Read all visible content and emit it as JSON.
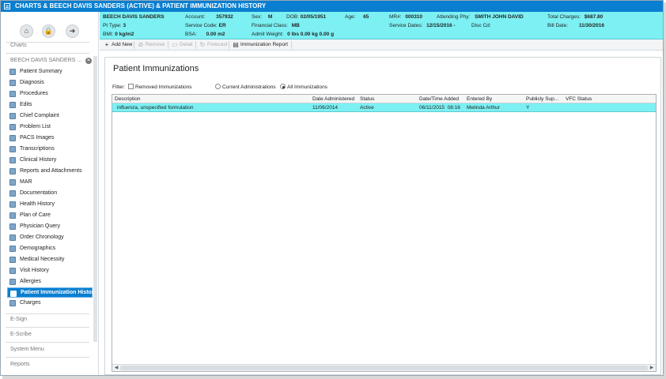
{
  "window": {
    "title": "CHARTS & BEECH DAVIS SANDERS (ACTIVE) & PATIENT IMMUNIZATION HISTORY"
  },
  "sidebar": {
    "icons": [
      "home-icon",
      "lock-icon",
      "logout-icon"
    ],
    "charts_label": "Charts",
    "patient_name": "BEECH DAVIS SANDERS ...",
    "items": [
      {
        "label": "Patient Summary",
        "icon": "summary-icon"
      },
      {
        "label": "Diagnosis",
        "icon": "diagnosis-icon"
      },
      {
        "label": "Procedures",
        "icon": "procedures-icon"
      },
      {
        "label": "Edits",
        "icon": "edits-icon"
      },
      {
        "label": "Chief Complaint",
        "icon": "complaint-icon"
      },
      {
        "label": "Problem List",
        "icon": "problem-list-icon"
      },
      {
        "label": "PACS Images",
        "icon": "images-icon"
      },
      {
        "label": "Transcriptions",
        "icon": "transcriptions-icon"
      },
      {
        "label": "Clinical History",
        "icon": "clinical-history-icon"
      },
      {
        "label": "Reports and Attachments",
        "icon": "reports-icon"
      },
      {
        "label": "MAR",
        "icon": "mar-icon"
      },
      {
        "label": "Documentation",
        "icon": "documentation-icon"
      },
      {
        "label": "Health History",
        "icon": "health-history-icon"
      },
      {
        "label": "Plan of Care",
        "icon": "plan-of-care-icon"
      },
      {
        "label": "Physician Query",
        "icon": "physician-query-icon"
      },
      {
        "label": "Order Chronology",
        "icon": "order-chronology-icon"
      },
      {
        "label": "Demographics",
        "icon": "demographics-icon"
      },
      {
        "label": "Medical Necessity",
        "icon": "medical-necessity-icon"
      },
      {
        "label": "Visit History",
        "icon": "visit-history-icon"
      },
      {
        "label": "Allergies",
        "icon": "allergies-icon"
      },
      {
        "label": "Patient Immunization History",
        "icon": "immunization-icon",
        "selected": true
      },
      {
        "label": "Charges",
        "icon": "charges-icon"
      }
    ],
    "sections": [
      "E-Sign",
      "E-Scribe",
      "System Menu",
      "Reports"
    ]
  },
  "patient": {
    "name": "BEECH DAVIS SANDERS",
    "pt_type_label": "Pt Type:",
    "pt_type": "3",
    "bmi_label": "BMI:",
    "bmi": "0 kg/m2",
    "account_label": "Account:",
    "account": "357932",
    "service_code_label": "Service Code:",
    "service_code": "ER",
    "bsa_label": "BSA:",
    "bsa": "0.00 m2",
    "sex_label": "Sex:",
    "sex": "M",
    "dob_label": "DOB:",
    "dob": "02/05/1951",
    "age_label": "Age:",
    "age": "65",
    "financial_class_label": "Financial Class:",
    "financial_class": "MB",
    "admit_weight_label": "Admit Weight:",
    "admit_weight": "0 lbs 0.00 kg 0.00 g",
    "mr_label": "MR#:",
    "mr": "000310",
    "attending_label": "Attending Phy:",
    "attending": "SMITH JOHN DAVID",
    "service_dates_label": "Service Dates:",
    "service_dates": "12/15/2016 -",
    "disc_cd_label": "Disc Cd:",
    "total_charges_label": "Total Charges:",
    "total_charges": "$687.80",
    "bill_date_label": "Bill Date:",
    "bill_date": "11/30/2016"
  },
  "toolbar": {
    "add_new": "Add New",
    "remove": "Remove",
    "detail": "Detail",
    "forecast": "Forecast",
    "immunization_report": "Immunization Report"
  },
  "main": {
    "title": "Patient Immunizations",
    "filter_label": "Filter:",
    "removed_immunizations": "Removed Immunizations",
    "removed_checked": false,
    "current_administrations": "Current Administrations",
    "all_immunizations": "All Immunizations",
    "selected_filter": "All Immunizations"
  },
  "table": {
    "columns": [
      "Description",
      "Date Administered",
      "Status",
      "Date/Time Added",
      "Entered By",
      "Publicly Sup...",
      "VFC Status"
    ],
    "rows": [
      [
        "influenza, unspecified formulation",
        "11/06/2014",
        "Active",
        "06/11/2015  08:16",
        "Melinda Arthur",
        "Y",
        ""
      ]
    ]
  },
  "colors": {
    "title_bar": "#0a7fd1",
    "info_bar": "#7cf0f3",
    "selected_row": "#7cf0f3"
  }
}
